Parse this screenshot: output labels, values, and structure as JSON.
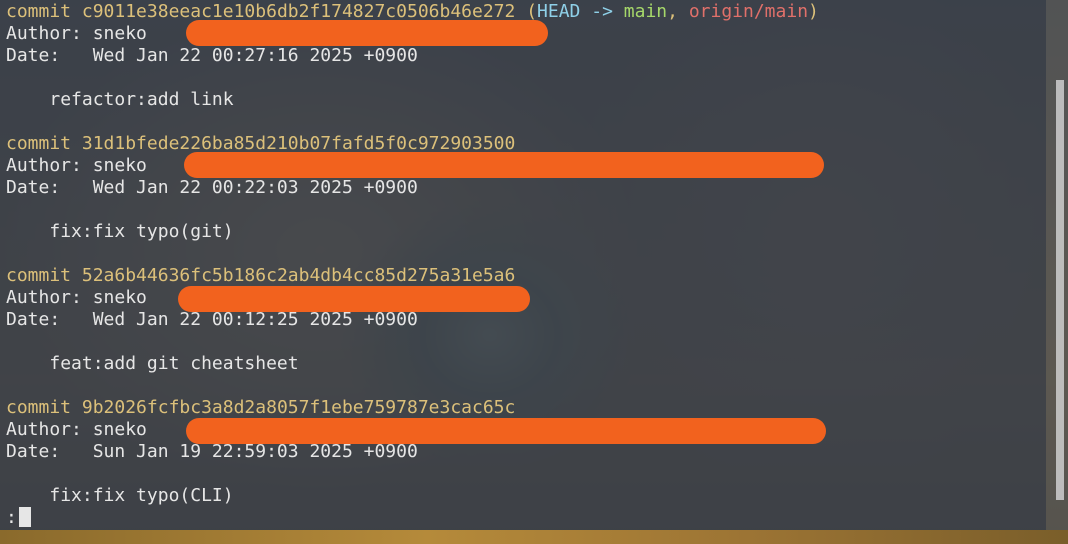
{
  "commits": [
    {
      "commit_label": "commit",
      "hash": "c9011e38eeac1e10b6db2f174827c0506b46e272",
      "refs": {
        "open": "(",
        "head": "HEAD",
        "arrow": "->",
        "branch": "main",
        "sep": ",",
        "remote": "origin/main",
        "close": ")"
      },
      "author_label": "Author:",
      "author": "sneko",
      "date_label": "Date:",
      "date": "Wed Jan 22 00:27:16 2025 +0900",
      "message": "refactor:add link"
    },
    {
      "commit_label": "commit",
      "hash": "31d1bfede226ba85d210b07fafd5f0c972903500",
      "author_label": "Author:",
      "author": "sneko",
      "date_label": "Date:",
      "date": "Wed Jan 22 00:22:03 2025 +0900",
      "message": "fix:fix typo(git)"
    },
    {
      "commit_label": "commit",
      "hash": "52a6b44636fc5b186c2ab4db4cc85d275a31e5a6",
      "author_label": "Author:",
      "author": "sneko",
      "date_label": "Date:",
      "date": "Wed Jan 22 00:12:25 2025 +0900",
      "message": "feat:add git cheatsheet"
    },
    {
      "commit_label": "commit",
      "hash": "9b2026fcfbc3a8d2a8057f1ebe759787e3cac65c",
      "author_label": "Author:",
      "author": "sneko",
      "date_label": "Date:",
      "date": "Sun Jan 19 22:59:03 2025 +0900",
      "message": "fix:fix typo(CLI)"
    }
  ],
  "prompt": ":",
  "colors": {
    "hash": "#dcc07a",
    "head": "#8fd0e8",
    "branch": "#a6d86a",
    "remote": "#e0706a",
    "redaction": "#f2621e"
  }
}
